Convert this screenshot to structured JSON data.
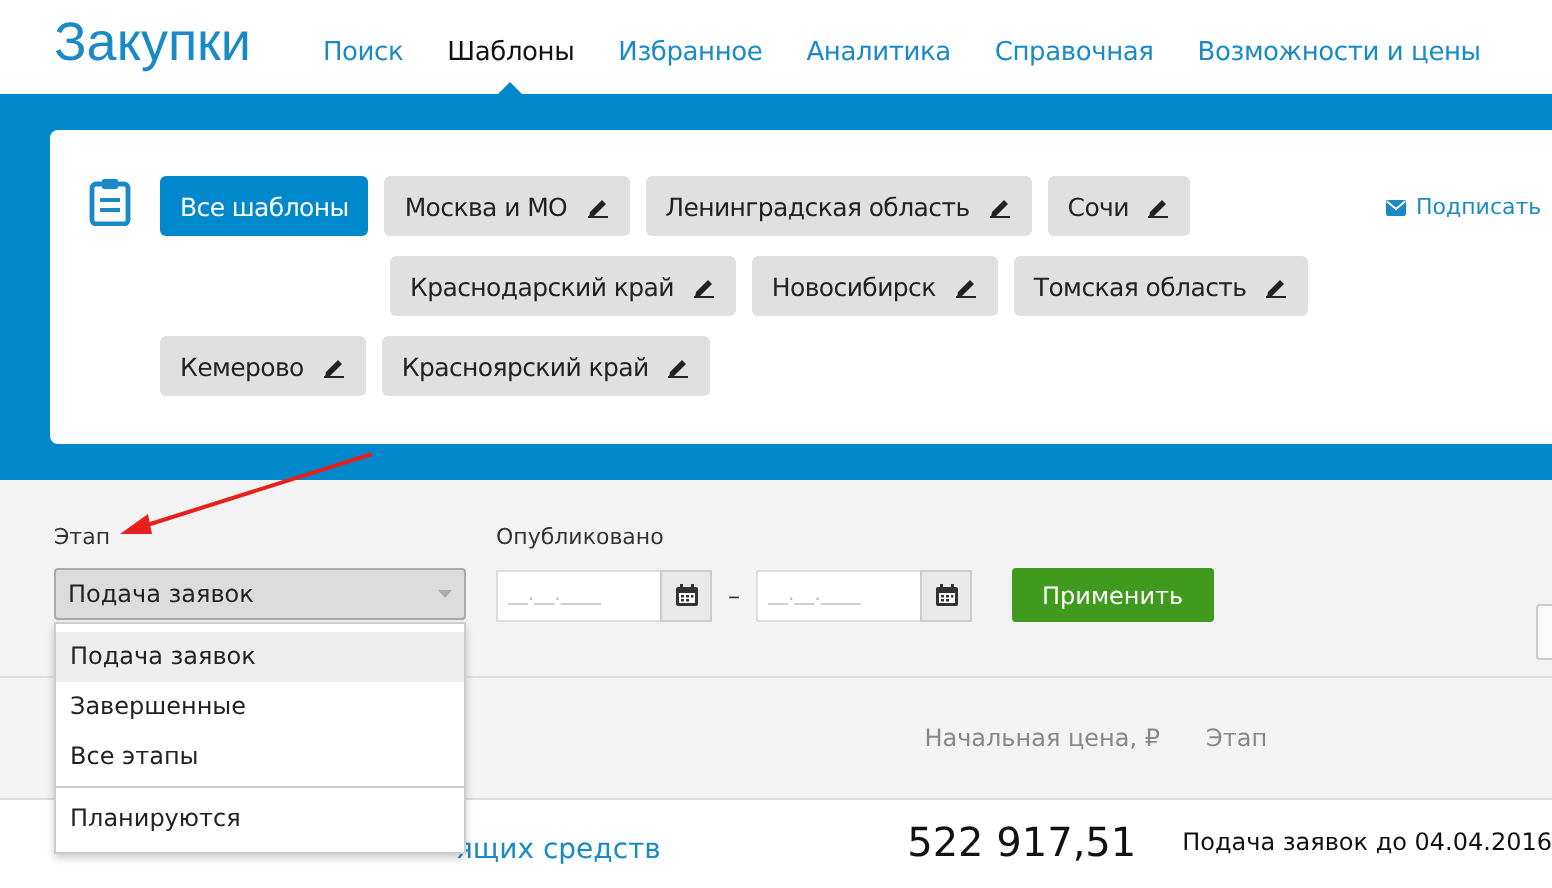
{
  "header": {
    "logo": "Закупки",
    "nav": [
      {
        "label": "Поиск",
        "selected": false
      },
      {
        "label": "Шаблоны",
        "selected": true
      },
      {
        "label": "Избранное",
        "selected": false
      },
      {
        "label": "Аналитика",
        "selected": false
      },
      {
        "label": "Справочная",
        "selected": false
      },
      {
        "label": "Возможности и цены",
        "selected": false
      }
    ]
  },
  "templates": {
    "chip_rows": [
      [
        {
          "label": "Все шаблоны",
          "selected": true,
          "editable": false
        },
        {
          "label": "Москва и МО",
          "selected": false,
          "editable": true
        },
        {
          "label": "Ленинградская область",
          "selected": false,
          "editable": true
        },
        {
          "label": "Сочи",
          "selected": false,
          "editable": true
        }
      ],
      [
        {
          "label": "Краснодарский край",
          "selected": false,
          "editable": true
        },
        {
          "label": "Новосибирск",
          "selected": false,
          "editable": true
        },
        {
          "label": "Томская область",
          "selected": false,
          "editable": true
        }
      ],
      [
        {
          "label": "Кемерово",
          "selected": false,
          "editable": true
        },
        {
          "label": "Красноярский край",
          "selected": false,
          "editable": true
        }
      ]
    ],
    "subscribe": "Подписать"
  },
  "filters": {
    "stage": {
      "label": "Этап",
      "value": "Подача заявок",
      "open": true,
      "options": [
        {
          "kind": "option",
          "label": "Подача заявок",
          "selected": true
        },
        {
          "kind": "option",
          "label": "Завершенные",
          "selected": false
        },
        {
          "kind": "option",
          "label": "Все этапы",
          "selected": false
        },
        {
          "kind": "divider"
        },
        {
          "kind": "option",
          "label": "Планируются",
          "selected": false
        }
      ]
    },
    "published": {
      "label": "Опубликовано",
      "from": {
        "placeholder": "__.__.____"
      },
      "dash": "–",
      "to": {
        "placeholder": "__.__.____"
      }
    },
    "apply": "Применить"
  },
  "table": {
    "columns": [
      {
        "label": "Начальная цена, ₽"
      },
      {
        "label": "Этап"
      }
    ],
    "rows": [
      {
        "title": "ящих средств",
        "price": "522 917,51",
        "stage": "Подача заявок до 04.04.2016"
      }
    ]
  }
}
